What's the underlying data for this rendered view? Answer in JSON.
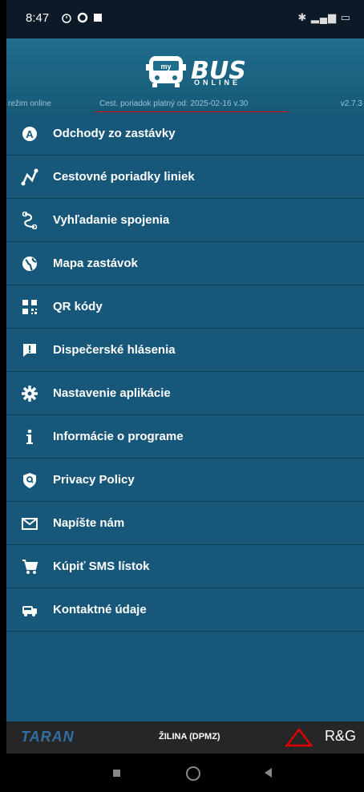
{
  "status_bar": {
    "time": "8:47",
    "right_icons": "✱ ▂▄▆ ▭"
  },
  "header": {
    "logo_my": "my",
    "logo_main": "BUS",
    "logo_sub": "ONLINE",
    "mode": "režim online",
    "validity": "Cest. poriadok platný od: 2025-02-16 v.30",
    "version": "v2.7.3"
  },
  "menu": [
    {
      "icon": "a-circle-icon",
      "label": "Odchody zo zastávky"
    },
    {
      "icon": "route-map-icon",
      "label": "Cestovné poriadky liniek"
    },
    {
      "icon": "connection-search-icon",
      "label": "Vyhľadanie spojenia"
    },
    {
      "icon": "globe-icon",
      "label": "Mapa zastávok"
    },
    {
      "icon": "qr-code-icon",
      "label": "QR kódy"
    },
    {
      "icon": "alert-message-icon",
      "label": "Dispečerské hlásenia"
    },
    {
      "icon": "gear-icon",
      "label": "Nastavenie aplikácie"
    },
    {
      "icon": "info-icon",
      "label": "Informácie o programe"
    },
    {
      "icon": "shield-icon",
      "label": "Privacy Policy"
    },
    {
      "icon": "mail-icon",
      "label": "Napíšte nám"
    },
    {
      "icon": "cart-icon",
      "label": "Kúpiť SMS lístok"
    },
    {
      "icon": "bus-contact-icon",
      "label": "Kontaktné údaje"
    }
  ],
  "footer": {
    "left_brand": "TARAN",
    "city": "ŽILINA (DPMZ)",
    "right_brand": "R&G"
  },
  "colors": {
    "header": "#1f6d8c",
    "menu": "#17577a",
    "accent_line": "#e00000"
  }
}
